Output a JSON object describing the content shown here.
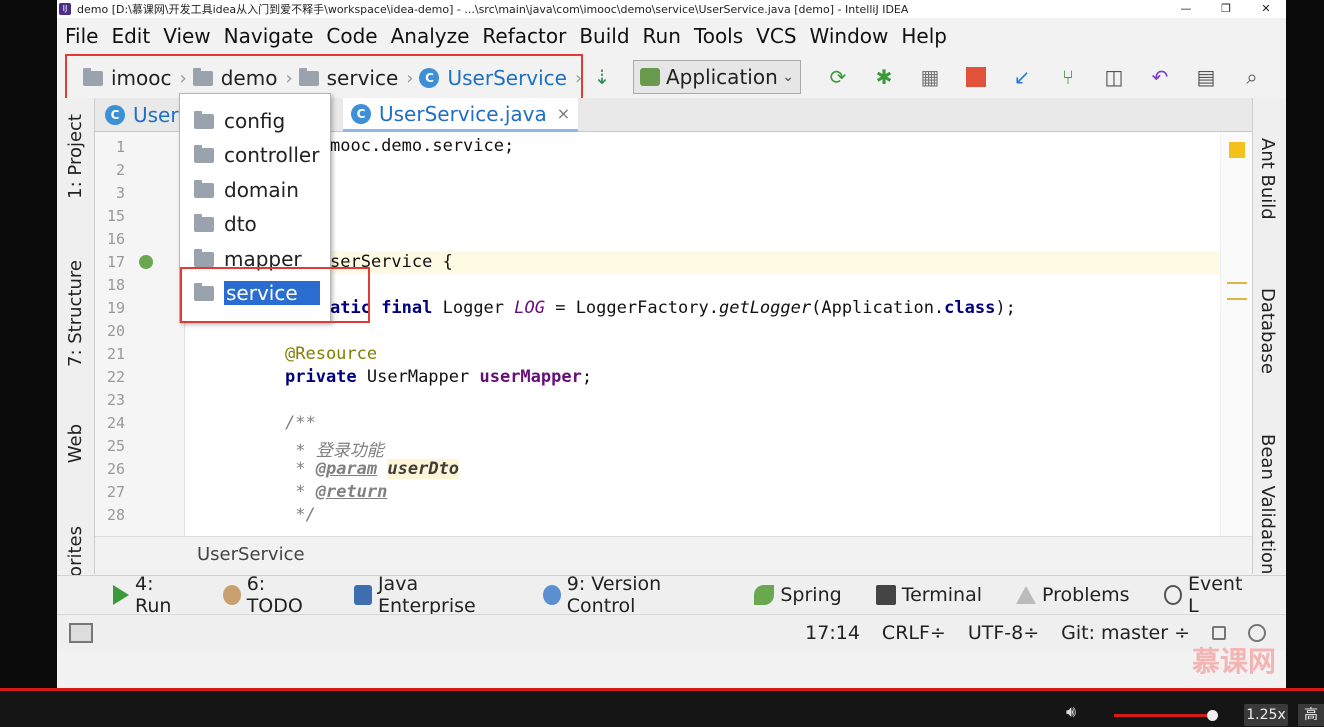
{
  "window": {
    "title": "demo [D:\\慕课网\\开发工具idea从入门到爱不释手\\workspace\\idea-demo] - ...\\src\\main\\java\\com\\imooc\\demo\\service\\UserService.java [demo] - IntelliJ IDEA",
    "icon": "IJ",
    "minimize": "—",
    "restore": "❐",
    "close": "✕"
  },
  "menu": [
    "File",
    "Edit",
    "View",
    "Navigate",
    "Code",
    "Analyze",
    "Refactor",
    "Build",
    "Run",
    "Tools",
    "VCS",
    "Window",
    "Help"
  ],
  "breadcrumb": {
    "items": [
      "imooc",
      "demo",
      "service",
      "UserService"
    ],
    "chevron": "›"
  },
  "toolbar": {
    "run_config": "Application",
    "icons": [
      "vcs-update-icon",
      "application-config-icon",
      "rerun-icon",
      "debug-icon",
      "coverage-icon",
      "stop-icon",
      "vcs-update-project-icon",
      "vcs-commit-icon",
      "vcs-history-icon",
      "revert-icon",
      "project-structure-icon",
      "search-everywhere-icon"
    ]
  },
  "left_tabs": [
    "1: Project",
    "7: Structure",
    "Web",
    "orites"
  ],
  "right_tabs": [
    "Ant Build",
    "Database",
    "Bean Validation"
  ],
  "tabs": [
    {
      "label": "User(",
      "icon": "C"
    },
    {
      "label": "UserService.java",
      "icon": "C",
      "close": "×"
    }
  ],
  "dropdown": {
    "items": [
      "config",
      "controller",
      "domain",
      "dto",
      "mapper",
      "service"
    ],
    "selected": "service"
  },
  "editor": {
    "line_numbers": [
      "1",
      "2",
      "3",
      "15",
      "16",
      "17",
      "18",
      "19",
      "20",
      "21",
      "22",
      "23",
      "24",
      "25",
      "26",
      "27",
      "28"
    ],
    "lines": {
      "l1_tail": "mooc.demo.service;",
      "l17_tail": "serService {",
      "l19_a": "atic ",
      "l19_b": "final ",
      "l19_c": "Logger ",
      "l19_d": "LOG",
      "l19_e": " = LoggerFactory.",
      "l19_f": "getLogger",
      "l19_g": "(Application.",
      "l19_h": "class",
      "l19_i": ");",
      "l21": "@Resource",
      "l22_a": "private ",
      "l22_b": "UserMapper ",
      "l22_c": "userMapper",
      "l22_d": ";",
      "l24": "/**",
      "l25": " * 登录功能",
      "l26_a": " * ",
      "l26_b": "@param",
      "l26_c": "userDto",
      "l27_a": " * ",
      "l27_b": "@return",
      "l28": " */"
    }
  },
  "bottom_breadcrumb": "UserService",
  "tool_windows": [
    {
      "label": "4: Run",
      "icon": "run-icon"
    },
    {
      "label": "6: TODO",
      "icon": "todo-icon"
    },
    {
      "label": "Java Enterprise",
      "icon": "java-enterprise-icon"
    },
    {
      "label": "9: Version Control",
      "icon": "version-control-icon"
    },
    {
      "label": "Spring",
      "icon": "spring-icon"
    },
    {
      "label": "Terminal",
      "icon": "terminal-icon"
    },
    {
      "label": "Problems",
      "icon": "problems-icon"
    },
    {
      "label": "Event L",
      "icon": "event-log-icon"
    }
  ],
  "status": {
    "position": "17:14",
    "line_sep": "CRLF÷",
    "encoding": "UTF-8÷",
    "git": "Git: master ÷"
  },
  "watermark": "慕课网",
  "player": {
    "speed": "1.25x",
    "quality": "高"
  },
  "colors": {
    "accent": "#2a6ccf",
    "highlight_box": "#e53935",
    "progress": "#d51a1a"
  }
}
